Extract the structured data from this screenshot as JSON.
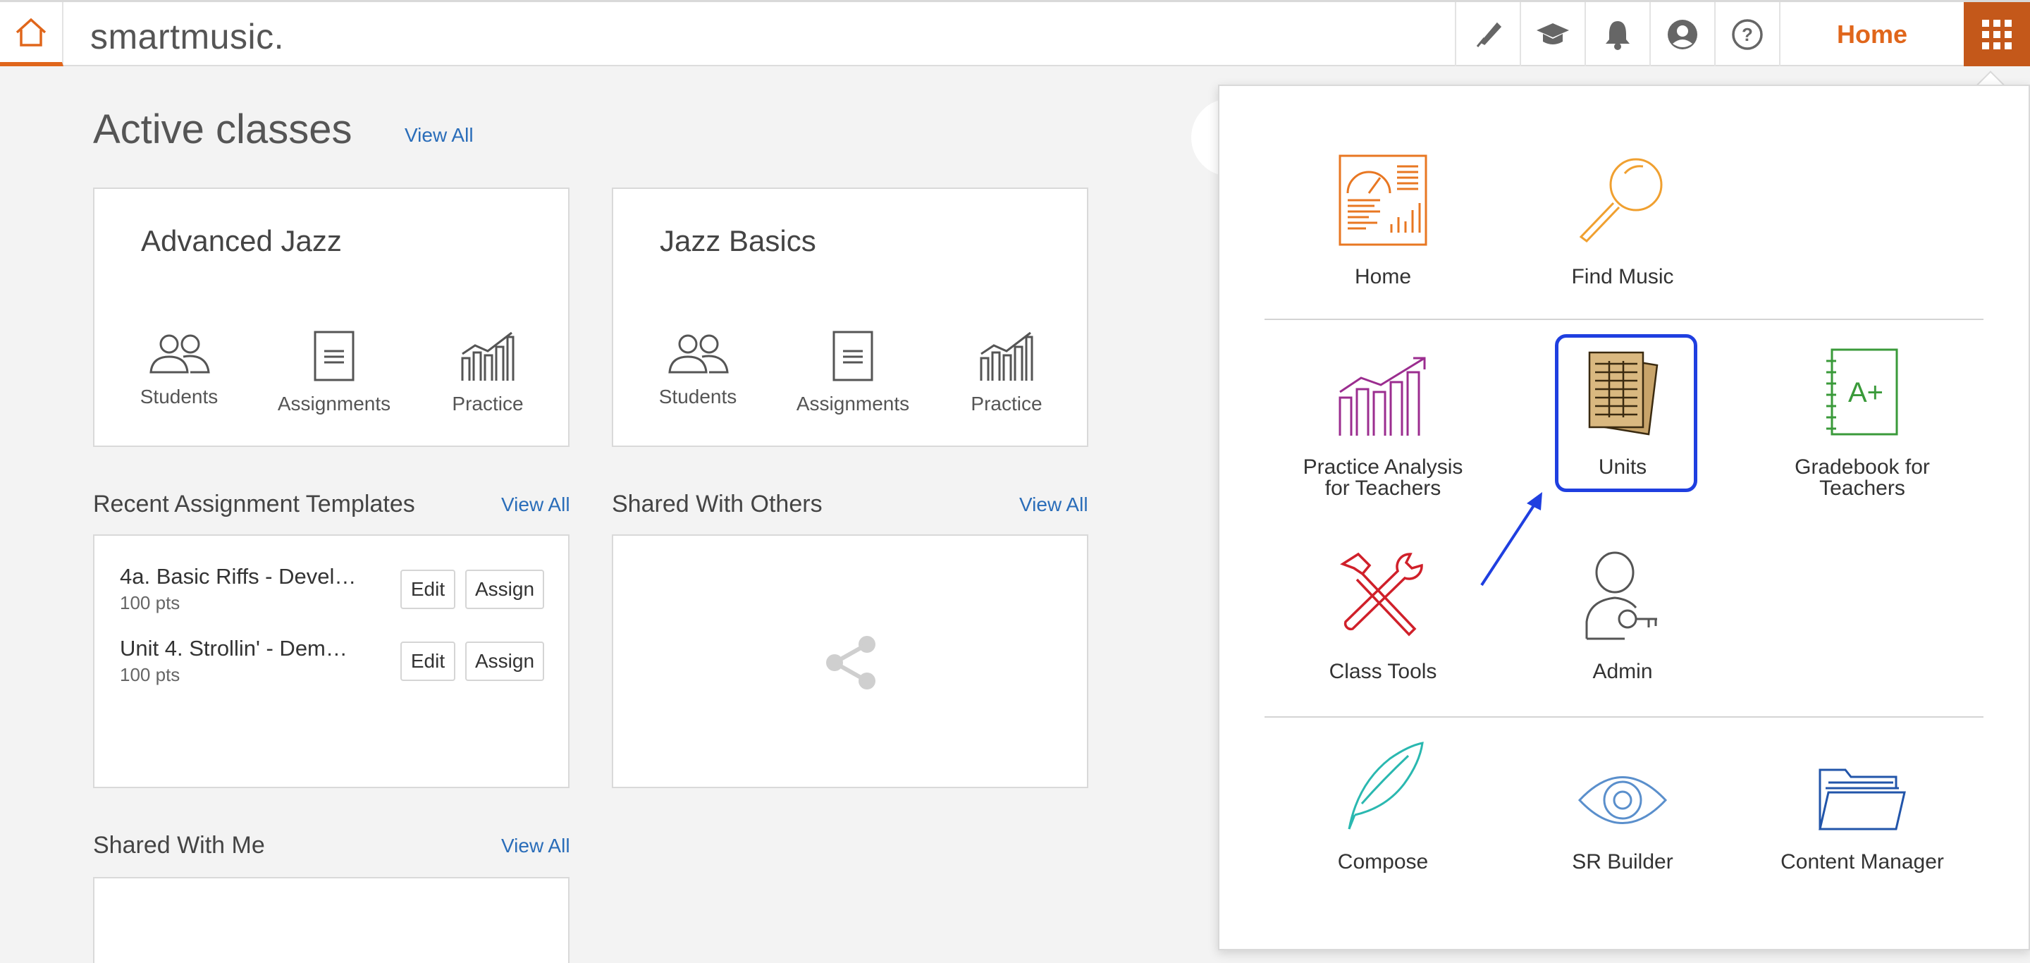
{
  "topbar": {
    "logo": "smartmusic.",
    "nav_home_label": "Home",
    "icons": [
      "tuner-icon",
      "graduation-cap-icon",
      "bell-icon",
      "account-icon",
      "help-icon"
    ]
  },
  "main": {
    "active_classes_title": "Active classes",
    "view_all": "View All",
    "classes": [
      {
        "name": "Advanced Jazz",
        "actions": [
          "Students",
          "Assignments",
          "Practice"
        ]
      },
      {
        "name": "Jazz Basics",
        "actions": [
          "Students",
          "Assignments",
          "Practice"
        ]
      }
    ],
    "recent_templates": {
      "title": "Recent Assignment Templates",
      "view_all": "View All",
      "items": [
        {
          "name": "4a. Basic Riffs - Devel…",
          "points": "100 pts",
          "edit": "Edit",
          "assign": "Assign"
        },
        {
          "name": "Unit 4. Strollin' - Dem…",
          "points": "100 pts",
          "edit": "Edit",
          "assign": "Assign"
        }
      ]
    },
    "shared_with_others": {
      "title": "Shared With Others",
      "view_all": "View All"
    },
    "shared_with_me": {
      "title": "Shared With Me",
      "view_all": "View All"
    }
  },
  "apps_panel": {
    "row1": [
      {
        "label": "Home",
        "icon": "dashboard-icon",
        "color": "#e87722"
      },
      {
        "label": "Find Music",
        "icon": "magnifier-icon",
        "color": "#f0a030"
      }
    ],
    "row2": [
      {
        "label": "Practice Analysis for Teachers",
        "icon": "growth-chart-icon",
        "color": "#9b2d8f"
      },
      {
        "label": "Units",
        "icon": "units-sheets-icon",
        "color": "#7a5a2b"
      },
      {
        "label": "Gradebook for Teachers",
        "icon": "gradebook-icon",
        "color": "#3a9a3a"
      }
    ],
    "row3": [
      {
        "label": "Class Tools",
        "icon": "tools-icon",
        "color": "#d0202a"
      },
      {
        "label": "Admin",
        "icon": "admin-user-key-icon",
        "color": "#555555"
      }
    ],
    "row4": [
      {
        "label": "Compose",
        "icon": "quill-icon",
        "color": "#2ab8b0"
      },
      {
        "label": "SR Builder",
        "icon": "eye-icon",
        "color": "#5a8fcc"
      },
      {
        "label": "Content Manager",
        "icon": "folder-icon",
        "color": "#2255aa"
      }
    ]
  },
  "colors": {
    "accent": "#e0661b",
    "link": "#2a6db9",
    "highlight": "#1f3fe0"
  }
}
